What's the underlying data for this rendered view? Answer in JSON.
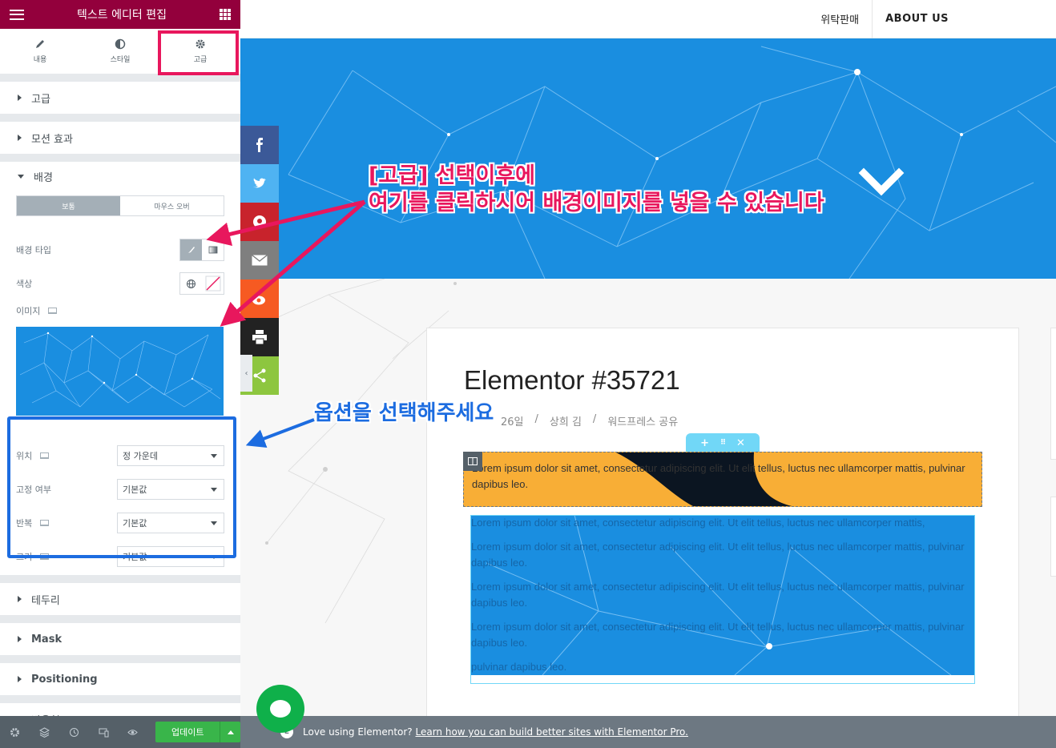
{
  "panel": {
    "title": "텍스트 에디터 편집",
    "tabs": [
      {
        "label": "내용",
        "icon": "pencil-icon"
      },
      {
        "label": "스타일",
        "icon": "half-circle-icon"
      },
      {
        "label": "고급",
        "icon": "gear-icon"
      }
    ],
    "sections_top": [
      "고급",
      "모션 효과"
    ],
    "background": {
      "title": "배경",
      "state_tabs": [
        "보통",
        "마우스 오버"
      ],
      "type_label": "배경 타입",
      "color_label": "색상",
      "image_label": "이미지",
      "position_label": "위치",
      "position_value": "정 가운데",
      "attachment_label": "고정 여부",
      "attachment_value": "기본값",
      "repeat_label": "반복",
      "repeat_value": "기본값",
      "size_label": "크기",
      "size_value": "기본값"
    },
    "sections_bottom": [
      "테두리",
      "Mask",
      "Positioning",
      "반응형"
    ],
    "footer": {
      "update_label": "업데이트"
    }
  },
  "preview": {
    "nav": [
      "위탁판매",
      "ABOUT US"
    ],
    "post_title": "Elementor #35721",
    "meta": [
      "26일",
      "/",
      "상희 김",
      "/",
      "워드프레스 공유"
    ],
    "orange_text": "Lorem ipsum dolor sit amet, consectetur adipiscing elit. Ut elit tellus, luctus nec ullamcorper mattis, pulvinar dapibus leo.",
    "blue_paragraphs": [
      "Lorem ipsum dolor sit amet, consectetur adipiscing elit. Ut elit tellus, luctus nec ullamcorper mattis,",
      "Lorem ipsum dolor sit amet, consectetur adipiscing elit. Ut elit tellus, luctus nec ullamcorper mattis, pulvinar dapibus leo.",
      "Lorem ipsum dolor sit amet, consectetur adipiscing elit. Ut elit tellus, luctus nec ullamcorper mattis, pulvinar dapibus leo.",
      "Lorem ipsum dolor sit amet, consectetur adipiscing elit. Ut elit tellus, luctus nec ullamcorper mattis, pulvinar dapibus leo.",
      "pulvinar dapibus leo."
    ],
    "notice_text": "Love using Elementor?",
    "notice_link": "Learn how you can build better sites with Elementor Pro."
  },
  "annotations": {
    "pink_line1": "[고급] 선택이후에",
    "pink_line2": "여기를 클릭하시어 배경이미지를 넣을 수 있습니다",
    "blue_note": "옵션을 선택해주세요"
  },
  "colors": {
    "header": "#93003c",
    "highlight": "#e8175d",
    "annot_blue": "#1c6ce0",
    "hero": "#1a8ee0",
    "orange": "#f8ae36",
    "update": "#39b54a"
  },
  "social_icons": [
    "facebook-icon",
    "twitter-icon",
    "pinterest-icon",
    "email-icon",
    "weibo-icon",
    "print-icon",
    "share-icon"
  ]
}
